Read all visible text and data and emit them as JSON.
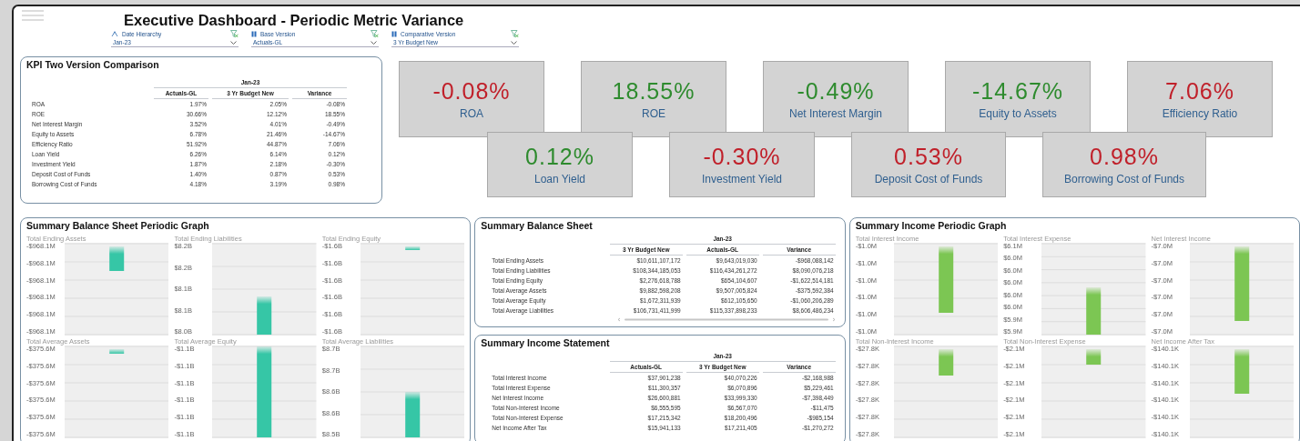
{
  "header": {
    "title": "Executive  Dashboard - Periodic Metric Variance",
    "filters": [
      {
        "label": "Date Hierarchy",
        "value": "Jan-23",
        "kind": "hierarchy"
      },
      {
        "label": "Base Version",
        "value": "Actuals-GL",
        "kind": "version"
      },
      {
        "label": "Comparative Version",
        "value": "3 Yr Budget New",
        "kind": "version"
      }
    ]
  },
  "kpi_table": {
    "title": "KPI Two Version Comparison",
    "period": "Jan-23",
    "columns": [
      "Actuals-GL",
      "3 Yr Budget New",
      "Variance"
    ],
    "rows": [
      {
        "label": "ROA",
        "values": [
          "1.97%",
          "2.05%",
          "-0.08%"
        ]
      },
      {
        "label": "ROE",
        "values": [
          "30.66%",
          "12.12%",
          "18.55%"
        ]
      },
      {
        "label": "Net Interest Margin",
        "values": [
          "3.52%",
          "4.01%",
          "-0.49%"
        ]
      },
      {
        "label": "Equity to Assets",
        "values": [
          "6.78%",
          "21.46%",
          "-14.67%"
        ]
      },
      {
        "label": "Efficiency Ratio",
        "values": [
          "51.92%",
          "44.87%",
          "7.06%"
        ]
      },
      {
        "label": "Loan Yield",
        "values": [
          "6.26%",
          "6.14%",
          "0.12%"
        ]
      },
      {
        "label": "Investment Yield",
        "values": [
          "1.87%",
          "2.18%",
          "-0.30%"
        ]
      },
      {
        "label": "Deposit Cost of Funds",
        "values": [
          "1.40%",
          "0.87%",
          "0.53%"
        ]
      },
      {
        "label": "Borrowing Cost of Funds",
        "values": [
          "4.18%",
          "3.19%",
          "0.98%"
        ]
      }
    ]
  },
  "kpi_tiles": [
    [
      {
        "value": "-0.08%",
        "label": "ROA",
        "color": "#c0202a"
      },
      {
        "value": "18.55%",
        "label": "ROE",
        "color": "#2e8b2e"
      },
      {
        "value": "-0.49%",
        "label": "Net Interest Margin",
        "color": "#2e8b2e"
      },
      {
        "value": "-14.67%",
        "label": "Equity to Assets",
        "color": "#2e8b2e"
      },
      {
        "value": "7.06%",
        "label": "Efficiency Ratio",
        "color": "#c0202a"
      }
    ],
    [
      {
        "value": "0.12%",
        "label": "Loan Yield",
        "color": "#2e8b2e"
      },
      {
        "value": "-0.30%",
        "label": "Investment Yield",
        "color": "#c0202a"
      },
      {
        "value": "0.53%",
        "label": "Deposit Cost of Funds",
        "color": "#c0202a"
      },
      {
        "value": "0.98%",
        "label": "Borrowing Cost of Funds",
        "color": "#c0202a"
      }
    ]
  ],
  "balance_graph": {
    "title": "Summary Balance Sheet Periodic Graph",
    "charts": [
      {
        "title": "Total Ending Assets",
        "axis_labels": [
          "-$968.1M",
          "-$968.1M",
          "-$968.1M",
          "-$968.1M",
          "-$968.1M",
          "-$968.1M"
        ]
      },
      {
        "title": "Total Ending Liabilities",
        "axis_labels": [
          "$8.2B",
          "$8.2B",
          "$8.1B",
          "$8.1B",
          "$8.0B"
        ]
      },
      {
        "title": "Total Ending Equity",
        "axis_labels": [
          "-$1.6B",
          "-$1.6B",
          "-$1.6B",
          "-$1.6B",
          "-$1.6B",
          "-$1.6B"
        ]
      },
      {
        "title": "Total Average Assets",
        "axis_labels": [
          "-$375.6M",
          "-$375.6M",
          "-$375.6M",
          "-$375.6M",
          "-$375.6M",
          "-$375.6M"
        ]
      },
      {
        "title": "Total Average Equity",
        "axis_labels": [
          "-$1.1B",
          "-$1.1B",
          "-$1.1B",
          "-$1.1B",
          "-$1.1B",
          "-$1.1B"
        ]
      },
      {
        "title": "Total Average Liabilities",
        "axis_labels": [
          "$8.7B",
          "$8.7B",
          "$8.6B",
          "$8.6B",
          "$8.5B"
        ]
      }
    ]
  },
  "balance_sheet": {
    "title": "Summary Balance Sheet",
    "period": "Jan-23",
    "columns": [
      "3 Yr Budget New",
      "Actuals-GL",
      "Variance"
    ],
    "rows": [
      {
        "label": "Total Ending Assets",
        "values": [
          "$10,611,107,172",
          "$9,643,019,030",
          "-$968,088,142"
        ]
      },
      {
        "label": "Total Ending Liabilities",
        "values": [
          "$108,344,185,053",
          "$116,434,261,272",
          "$8,090,076,218"
        ]
      },
      {
        "label": "Total Ending Equity",
        "values": [
          "$2,276,618,788",
          "$654,104,607",
          "-$1,622,514,181"
        ]
      },
      {
        "label": "Total Average Assets",
        "values": [
          "$9,882,598,208",
          "$9,507,005,824",
          "-$375,592,384"
        ]
      },
      {
        "label": "Total Average Equity",
        "values": [
          "$1,672,311,939",
          "$612,105,650",
          "-$1,060,206,289"
        ]
      },
      {
        "label": "Total Average Liabilities",
        "values": [
          "$106,731,411,999",
          "$115,337,898,233",
          "$8,606,486,234"
        ]
      }
    ]
  },
  "income_statement": {
    "title": "Summary Income Statement",
    "period": "Jan-23",
    "columns": [
      "Actuals-GL",
      "3 Yr Budget New",
      "Variance"
    ],
    "rows": [
      {
        "label": "Total Interest Income",
        "values": [
          "$37,901,238",
          "$40,070,226",
          "-$2,168,988"
        ]
      },
      {
        "label": "Total Interest Expense",
        "values": [
          "$11,300,357",
          "$6,070,896",
          "$5,229,461"
        ]
      },
      {
        "label": "Net Interest Income",
        "values": [
          "$26,600,881",
          "$33,999,330",
          "-$7,398,449"
        ]
      },
      {
        "label": "Total Non-Interest Income",
        "values": [
          "$6,555,595",
          "$6,567,070",
          "-$11,475"
        ]
      },
      {
        "label": "Total Non-Interest Expense",
        "values": [
          "$17,215,342",
          "$18,200,496",
          "-$985,154"
        ]
      },
      {
        "label": "Net Income After Tax",
        "values": [
          "$15,941,133",
          "$17,211,405",
          "-$1,270,272"
        ]
      }
    ]
  },
  "income_graph": {
    "title": "Summary Income Periodic Graph",
    "charts": [
      {
        "title": "Total Interest Income",
        "axis_labels": [
          "-$1.0M",
          "-$1.0M",
          "-$1.0M",
          "-$1.0M",
          "-$1.0M",
          "-$1.0M"
        ]
      },
      {
        "title": "Total Interest Expense",
        "axis_labels": [
          "$6.1M",
          "$6.0M",
          "$6.0M",
          "$6.0M",
          "$6.0M",
          "$6.0M",
          "$5.9M",
          "$5.9M"
        ]
      },
      {
        "title": "Net Interest Income",
        "axis_labels": [
          "-$7.0M",
          "-$7.0M",
          "-$7.0M",
          "-$7.0M",
          "-$7.0M",
          "-$7.0M"
        ]
      },
      {
        "title": "Total Non-Interest Income",
        "axis_labels": [
          "-$27.8K",
          "-$27.8K",
          "-$27.8K",
          "-$27.8K",
          "-$27.8K",
          "-$27.8K"
        ]
      },
      {
        "title": "Total Non-Interest Expense",
        "axis_labels": [
          "-$2.1M",
          "-$2.1M",
          "-$2.1M",
          "-$2.1M",
          "-$2.1M",
          "-$2.1M"
        ]
      },
      {
        "title": "Net Income After Tax",
        "axis_labels": [
          "-$140.1K",
          "-$140.1K",
          "-$140.1K",
          "-$140.1K",
          "-$140.1K",
          "-$140.1K"
        ]
      }
    ]
  }
}
